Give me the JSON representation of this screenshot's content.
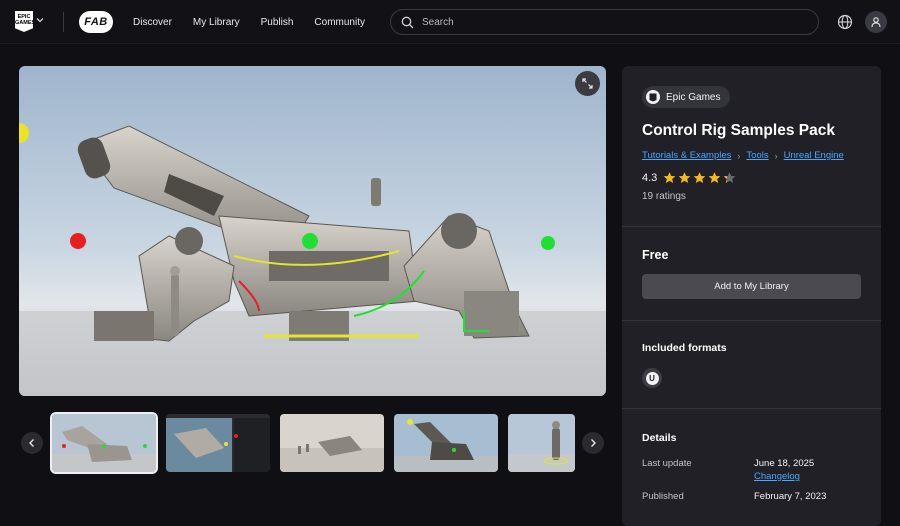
{
  "topbar": {
    "epic_logo_text": "EPIC GAMES",
    "fab_logo_text": "FAB",
    "nav": [
      "Discover",
      "My Library",
      "Publish",
      "Community"
    ],
    "search_placeholder": "Search"
  },
  "product": {
    "seller": "Epic Games",
    "title": "Control Rig Samples Pack",
    "breadcrumbs": [
      "Tutorials & Examples",
      "Tools",
      "Unreal Engine"
    ],
    "rating": "4.3",
    "rating_value": 4.3,
    "rating_max": 5,
    "ratings_count": "19 ratings",
    "price": "Free",
    "add_button": "Add to My Library",
    "included_formats_heading": "Included formats",
    "format_icon": "unreal-engine-icon",
    "details_heading": "Details",
    "details": [
      {
        "label": "Last update",
        "value": "June 18, 2025",
        "link": "Changelog"
      },
      {
        "label": "Published",
        "value": "February 7, 2023"
      }
    ]
  },
  "gallery": {
    "thumbnail_count": 5,
    "active_index": 0
  },
  "colors": {
    "background": "#101014",
    "panel": "#202026",
    "link": "#4aa8ff",
    "star": "#f5b81c"
  }
}
